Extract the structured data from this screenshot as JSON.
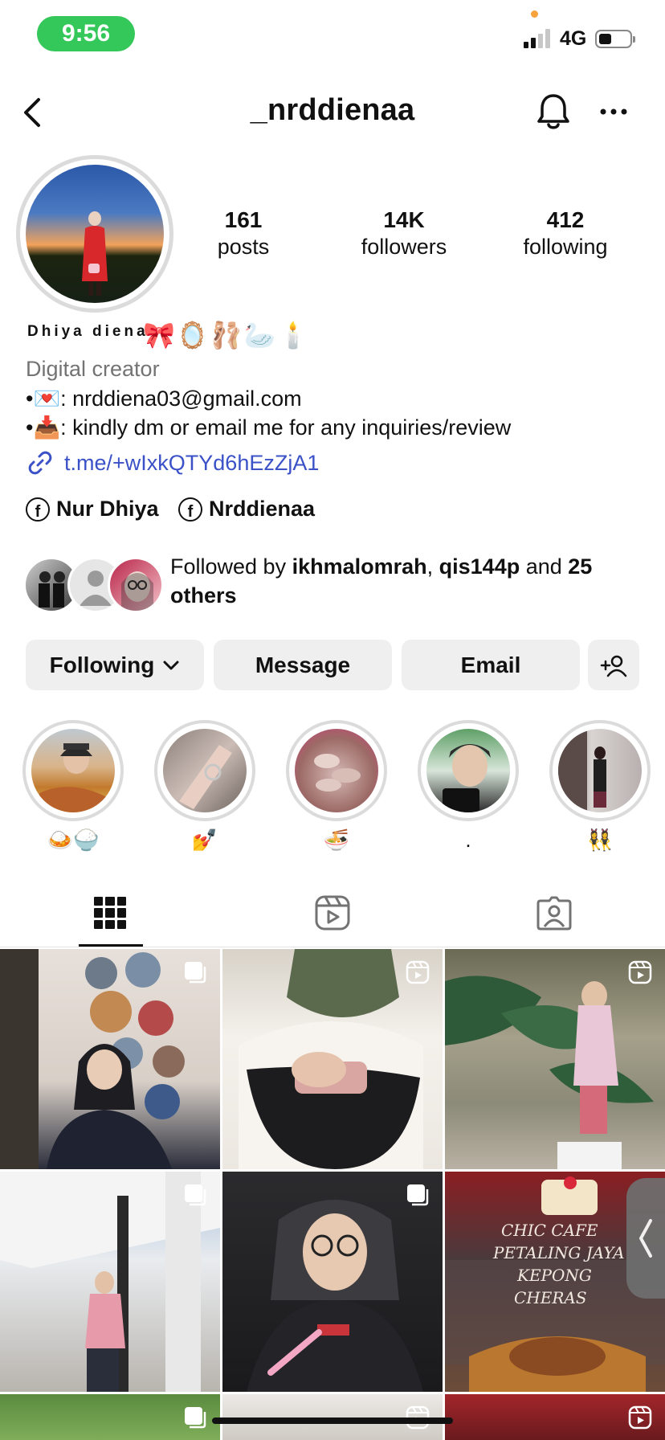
{
  "status_bar": {
    "time": "9:56",
    "network": "4G"
  },
  "header": {
    "username": "_nrddienaa"
  },
  "stats": [
    {
      "value": "161",
      "label": "posts"
    },
    {
      "value": "14K",
      "label": "followers"
    },
    {
      "value": "412",
      "label": "following"
    }
  ],
  "bio": {
    "display_name": "Dhiya diena",
    "name_emojis": "🎀🪞🩰🦢🕯️",
    "category": "Digital creator",
    "line1": "•💌: nrddiena03@gmail.com",
    "line2": "•📥: kindly dm or email me for any inquiries/review",
    "link": "t.me/+wIxkQTYd6hEzZjA1"
  },
  "facebook_links": [
    {
      "label": "Nur Dhiya"
    },
    {
      "label": "Nrddienaa"
    }
  ],
  "followed_by": {
    "prefix": "Followed by ",
    "user1": "ikhmalomrah",
    "sep": ", ",
    "user2": "qis144p",
    "and": " and ",
    "others": "25 others"
  },
  "buttons": {
    "following": "Following",
    "message": "Message",
    "email": "Email"
  },
  "highlights": [
    {
      "label": "🍛🍚"
    },
    {
      "label": "💅"
    },
    {
      "label": "🍜"
    },
    {
      "label": "."
    },
    {
      "label": "👯‍♀️"
    }
  ],
  "tabs": [
    "posts-grid",
    "reels",
    "tagged"
  ],
  "colors": {
    "status_green": "#34c759",
    "link_blue": "#3a51c7",
    "button_gray": "#efefef",
    "muted_text": "#737373"
  },
  "grid_overlay_text": {
    "cafe_sign": "CHIC CAFE\nPETALING JAYA\nKEPONG\nCHERAS"
  }
}
